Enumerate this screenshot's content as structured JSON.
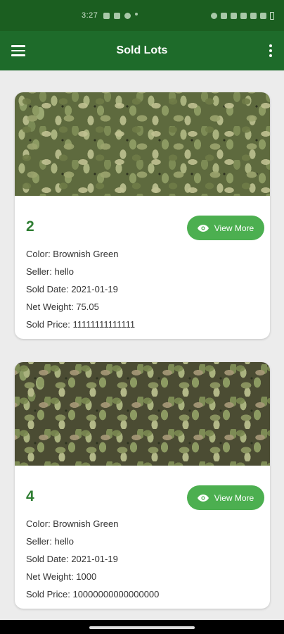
{
  "status_bar": {
    "time": "3:27"
  },
  "app_bar": {
    "title": "Sold Lots"
  },
  "lots": [
    {
      "number": "2",
      "view_label": "View More",
      "color": "Color: Brownish Green",
      "seller": "Seller: hello",
      "sold_date": "Sold Date: 2021-01-19",
      "net_weight": "Net Weight: 75.05",
      "sold_price": "Sold Price: 11111111111111"
    },
    {
      "number": "4",
      "view_label": "View More",
      "color": "Color: Brownish Green",
      "seller": "Seller: hello",
      "sold_date": "Sold Date: 2021-01-19",
      "net_weight": "Net Weight: 1000",
      "sold_price": "Sold Price: 10000000000000000"
    }
  ],
  "colors": {
    "status_bar": "#1b5e20",
    "app_bar": "#1e6b2a",
    "accent": "#4caf50",
    "lot_number": "#2e7d32"
  },
  "icons": {
    "menu": "hamburger-menu-icon",
    "more": "more-vert-icon",
    "view": "eye-icon"
  }
}
